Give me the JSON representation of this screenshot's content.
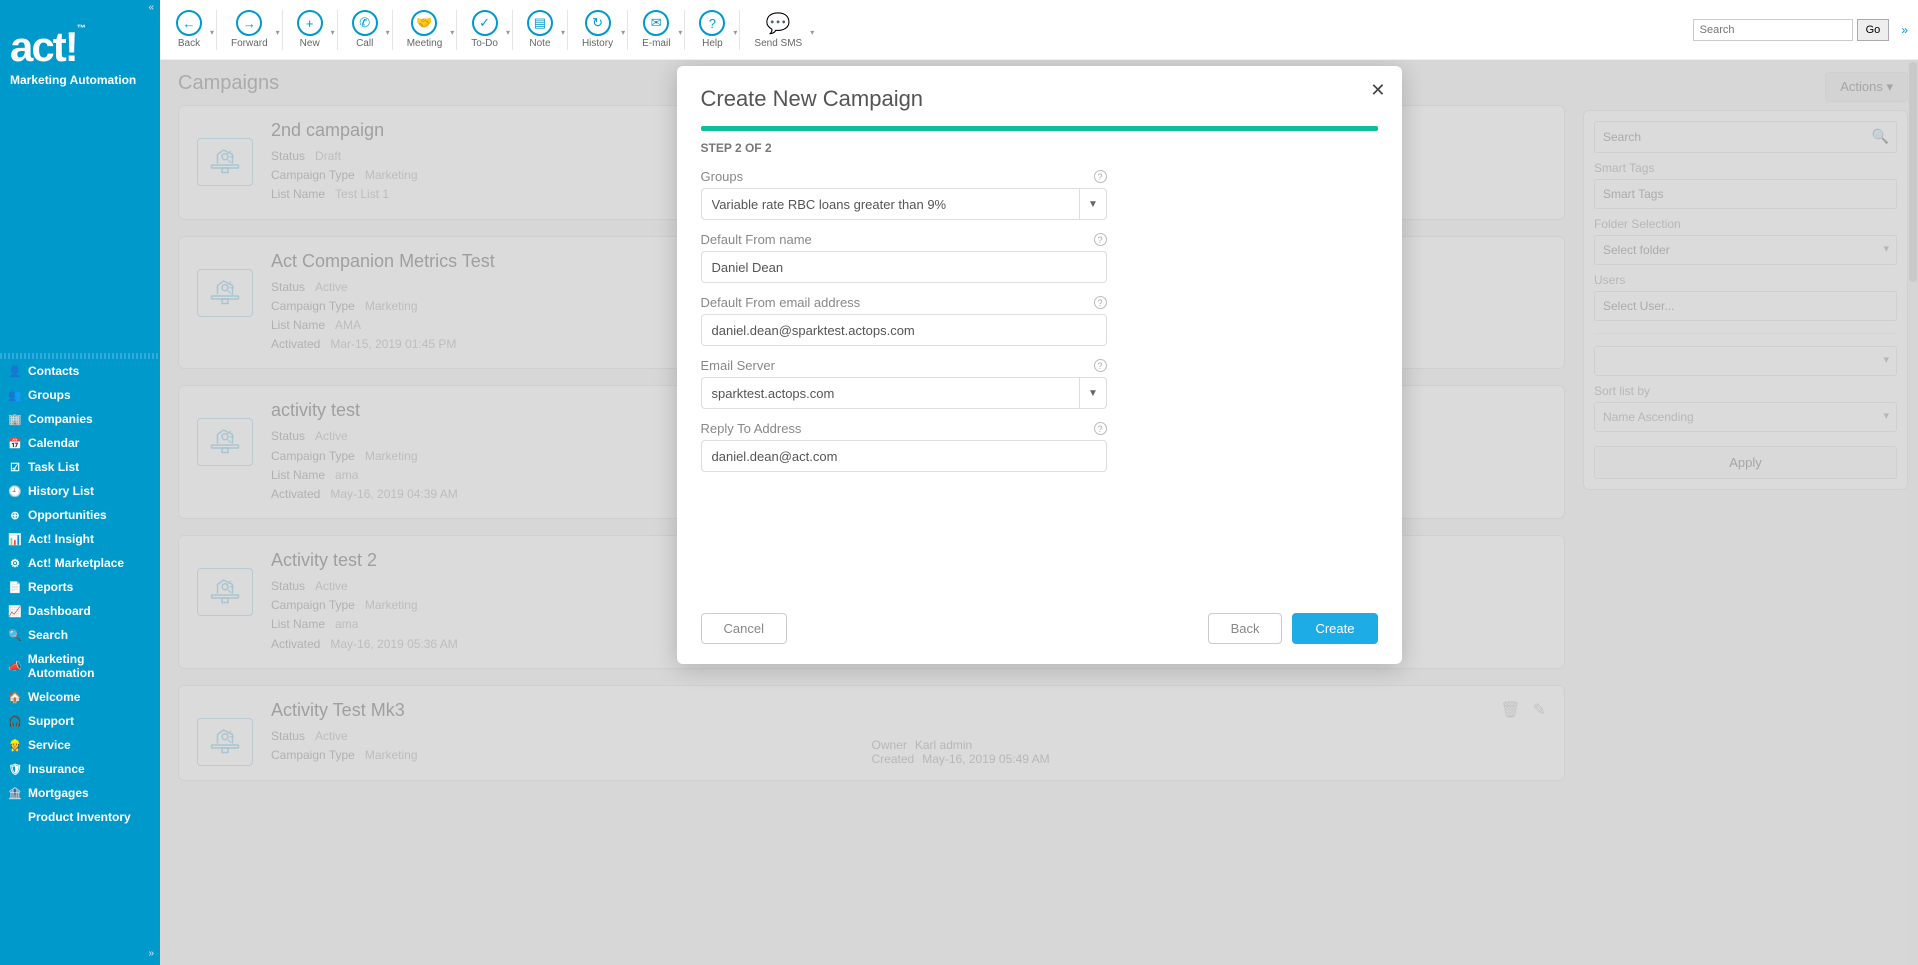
{
  "logo": {
    "text": "act!",
    "sub": "Marketing Automation"
  },
  "nav": [
    {
      "label": "Contacts",
      "icon": "👤"
    },
    {
      "label": "Groups",
      "icon": "👥"
    },
    {
      "label": "Companies",
      "icon": "🏢"
    },
    {
      "label": "Calendar",
      "icon": "📅"
    },
    {
      "label": "Task List",
      "icon": "☑"
    },
    {
      "label": "History List",
      "icon": "🕘"
    },
    {
      "label": "Opportunities",
      "icon": "⊕"
    },
    {
      "label": "Act! Insight",
      "icon": "📊"
    },
    {
      "label": "Act! Marketplace",
      "icon": "⚙"
    },
    {
      "label": "Reports",
      "icon": "📄"
    },
    {
      "label": "Dashboard",
      "icon": "📈"
    },
    {
      "label": "Search",
      "icon": "🔍"
    },
    {
      "label": "Marketing Automation",
      "icon": "📣"
    },
    {
      "label": "Welcome",
      "icon": "🏠"
    },
    {
      "label": "Support",
      "icon": "🎧"
    },
    {
      "label": "Service",
      "icon": "👷"
    },
    {
      "label": "Insurance",
      "icon": "🛡"
    },
    {
      "label": "Mortgages",
      "icon": "🏦"
    },
    {
      "label": "Product Inventory",
      "icon": ""
    }
  ],
  "toolbar": {
    "items": [
      {
        "label": "Back",
        "glyph": "←"
      },
      {
        "label": "Forward",
        "glyph": "→"
      },
      {
        "label": "New",
        "glyph": "+"
      },
      {
        "label": "Call",
        "glyph": "✆"
      },
      {
        "label": "Meeting",
        "glyph": "🤝"
      },
      {
        "label": "To-Do",
        "glyph": "✓"
      },
      {
        "label": "Note",
        "glyph": "▤"
      },
      {
        "label": "History",
        "glyph": "↻"
      },
      {
        "label": "E-mail",
        "glyph": "✉"
      },
      {
        "label": "Help",
        "glyph": "?"
      },
      {
        "label": "Send SMS",
        "glyph": "💬"
      }
    ],
    "search_placeholder": "Search",
    "go": "Go"
  },
  "page": {
    "title": "Campaigns",
    "actions_label": "Actions ▾"
  },
  "campaigns": [
    {
      "title": "2nd campaign",
      "rows": [
        {
          "k": "Status",
          "v": "Draft"
        },
        {
          "k": "Campaign Type",
          "v": "Marketing"
        },
        {
          "k": "List Name",
          "v": "Test List 1"
        }
      ]
    },
    {
      "title": "Act Companion Metrics Test",
      "rows": [
        {
          "k": "Status",
          "v": "Active"
        },
        {
          "k": "Campaign Type",
          "v": "Marketing"
        },
        {
          "k": "List Name",
          "v": "AMA"
        },
        {
          "k": "Activated",
          "v": "Mar-15, 2019 01:45 PM"
        }
      ]
    },
    {
      "title": "activity test",
      "rows": [
        {
          "k": "Status",
          "v": "Active"
        },
        {
          "k": "Campaign Type",
          "v": "Marketing"
        },
        {
          "k": "List Name",
          "v": "ama"
        },
        {
          "k": "Activated",
          "v": "May-16, 2019 04:39 AM"
        }
      ]
    },
    {
      "title": "Activity test 2",
      "rows": [
        {
          "k": "Status",
          "v": "Active"
        },
        {
          "k": "Campaign Type",
          "v": "Marketing"
        },
        {
          "k": "List Name",
          "v": "ama"
        },
        {
          "k": "Activated",
          "v": "May-16, 2019 05:36 AM"
        }
      ]
    },
    {
      "title": "Activity Test Mk3",
      "rows": [
        {
          "k": "Status",
          "v": "Active"
        },
        {
          "k": "Campaign Type",
          "v": "Marketing"
        }
      ],
      "owner": [
        {
          "k": "Owner",
          "v": "Karl admin"
        },
        {
          "k": "Created",
          "v": "May-16, 2019 05:49 AM"
        }
      ]
    }
  ],
  "right_panel": {
    "search_placeholder": "Search",
    "smart_tags_label": "Smart Tags",
    "smart_tags_placeholder": "Smart Tags",
    "folder_label": "Folder Selection",
    "folder_placeholder": "Select folder",
    "users_label": "Users",
    "users_placeholder": "Select User...",
    "sort_label": "Sort list by",
    "sort_value": "Name Ascending",
    "blank_select": "",
    "apply": "Apply"
  },
  "modal": {
    "title": "Create New Campaign",
    "step": "STEP 2 OF 2",
    "groups_label": "Groups",
    "groups_value": "Variable rate RBC loans greater than 9%",
    "from_name_label": "Default From name",
    "from_name_value": "Daniel Dean",
    "from_email_label": "Default From email address",
    "from_email_value": "daniel.dean@sparktest.actops.com",
    "email_server_label": "Email Server",
    "email_server_value": "sparktest.actops.com",
    "reply_to_label": "Reply To Address",
    "reply_to_value": "daniel.dean@act.com",
    "cancel": "Cancel",
    "back": "Back",
    "create": "Create"
  }
}
